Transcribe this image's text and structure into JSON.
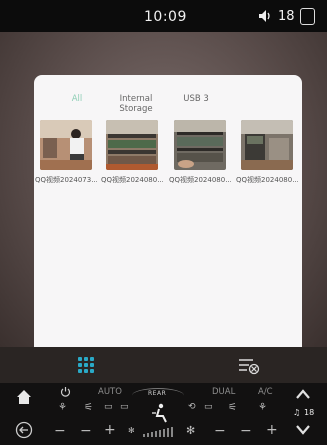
{
  "status_bar": {
    "time": "10:09",
    "volume": "18"
  },
  "gallery": {
    "tabs": [
      {
        "label": "All",
        "active": true
      },
      {
        "label": "Internal Storage",
        "active": false
      },
      {
        "label": "USB 3",
        "active": false
      }
    ],
    "items": [
      {
        "label": "QQ视频2024073..."
      },
      {
        "label": "QQ视频2024080..."
      },
      {
        "label": "QQ视频2024080..."
      },
      {
        "label": "QQ视频2024080..."
      }
    ]
  },
  "climate": {
    "auto_label": "AUTO",
    "rear_label": "REAR",
    "dual_label": "DUAL",
    "ac_label": "A/C",
    "fan_level": "18"
  },
  "colors": {
    "accent": "#8fcfb6",
    "grid_icon": "#2aa9c6"
  }
}
